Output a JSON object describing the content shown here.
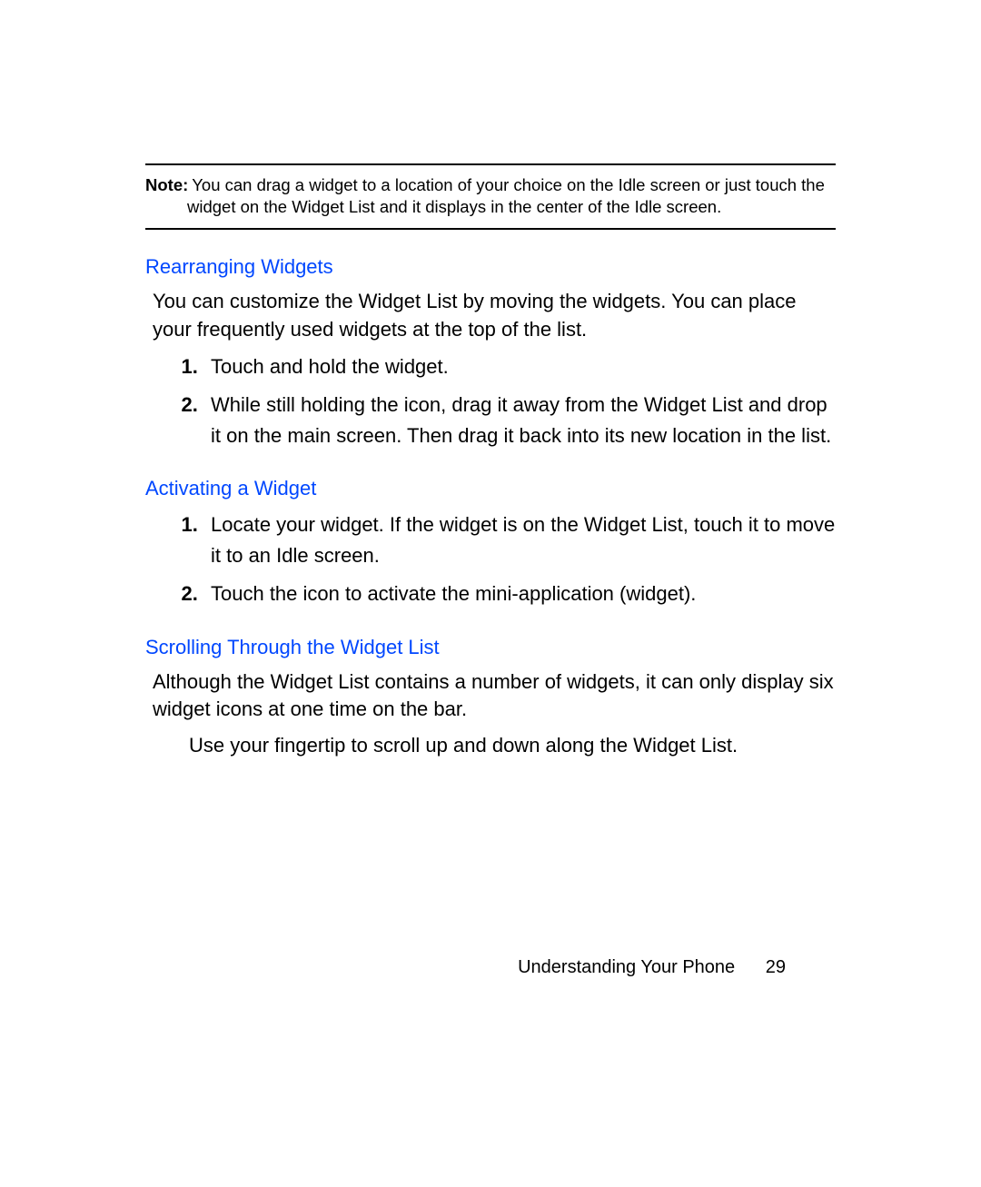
{
  "note": {
    "label": "Note:",
    "text": "You can drag a widget to a location of your choice on the Idle screen or just touch the widget on the Widget List and it displays in the center of the Idle screen."
  },
  "sections": {
    "rearranging": {
      "heading": "Rearranging Widgets",
      "intro": "You can customize the Widget List by moving the widgets. You can place your frequently used widgets at the top of the list.",
      "steps": [
        "Touch and hold the widget.",
        "While still holding the icon, drag it away from the Widget List and drop it on the main screen. Then drag it back into its new location in the list."
      ]
    },
    "activating": {
      "heading": "Activating a Widget",
      "steps": [
        "Locate your widget. If the widget is on the Widget List, touch it to move it to an Idle screen.",
        "Touch the icon to activate the mini-application (widget)."
      ]
    },
    "scrolling": {
      "heading": "Scrolling Through the Widget List",
      "intro": "Although the Widget List contains a number of widgets, it can only display six widget icons at one time on the bar.",
      "instruction": "Use your fingertip to scroll up and down along the Widget List."
    }
  },
  "footer": {
    "chapter": "Understanding Your Phone",
    "page": "29"
  }
}
